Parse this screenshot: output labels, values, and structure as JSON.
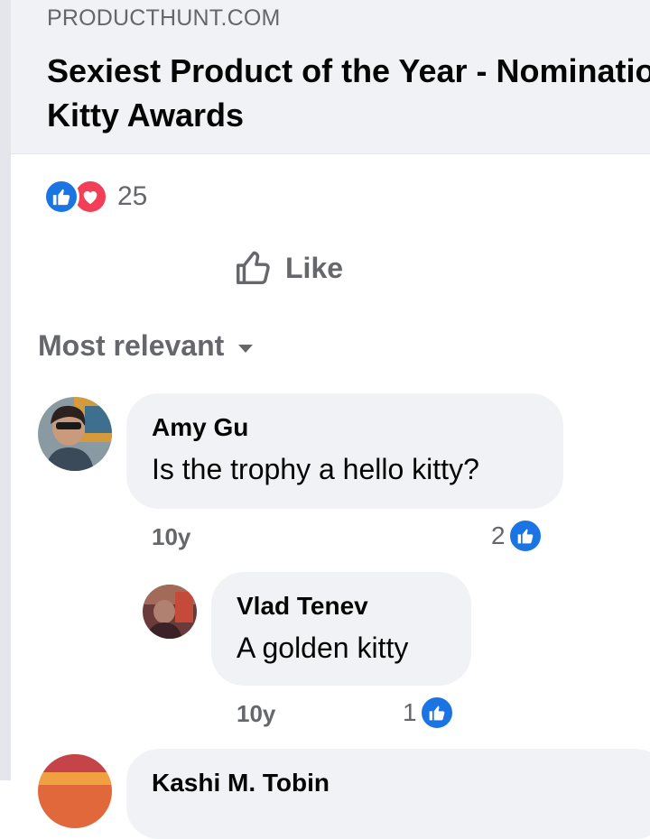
{
  "link_preview": {
    "domain": "PRODUCTHUNT.COM",
    "title": "Sexiest Product of the Year - Nominations for the Golden Kitty Awards"
  },
  "reactions": {
    "count": "25",
    "icons": [
      "like-icon",
      "love-icon"
    ]
  },
  "actions": {
    "like_label": "Like"
  },
  "comments_sort": {
    "label": "Most relevant"
  },
  "comments": [
    {
      "author": "Amy Gu",
      "text": "Is the trophy a hello kitty?",
      "time": "10y",
      "likes": "2",
      "replies": [
        {
          "author": "Vlad Tenev",
          "text": "A golden kitty",
          "time": "10y",
          "likes": "1"
        }
      ]
    }
  ],
  "next_comment": {
    "author": "Kashi M. Tobin"
  },
  "colors": {
    "accent_blue": "#1b74e4",
    "love_red": "#f33e58",
    "secondary_text": "#65676b",
    "bubble_bg": "#f0f2f5"
  }
}
